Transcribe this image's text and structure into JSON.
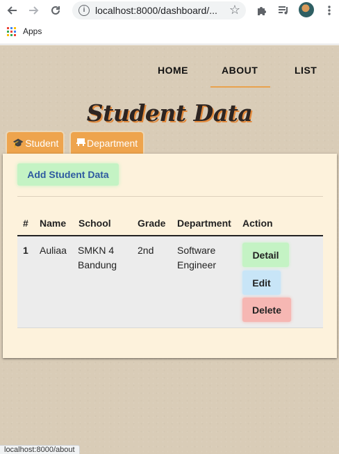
{
  "browser": {
    "url": "localhost:8000/dashboard/...",
    "bookmarks_apps_label": "Apps",
    "status_url": "localhost:8000/about",
    "icons": [
      "back-icon",
      "forward-icon",
      "reload-icon",
      "info-icon",
      "star-icon",
      "extensions-icon",
      "media-icon",
      "avatar",
      "menu-icon"
    ]
  },
  "nav": {
    "home": "HOME",
    "about": "ABOUT",
    "list": "LIST"
  },
  "page_title": "Student Data",
  "tabs": {
    "student": "Student",
    "department": "Department"
  },
  "add_button": "Add Student Data",
  "table": {
    "headers": [
      "#",
      "Name",
      "School",
      "Grade",
      "Department",
      "Action"
    ],
    "rows": [
      {
        "num": "1",
        "name": "Auliaa",
        "school_line1": "SMKN 4",
        "school_line2": "Bandung",
        "grade": "2nd",
        "department_line1": "Software",
        "department_line2": "Engineer",
        "actions": [
          "Detail",
          "Edit",
          "Delete"
        ]
      }
    ]
  },
  "colors": {
    "accent": "#eea44d",
    "background": "#d9ccb7",
    "card": "#fdf2dc",
    "detail": "#c4f3c4",
    "edit": "#c8e5f7",
    "delete": "#f6b7b3"
  }
}
